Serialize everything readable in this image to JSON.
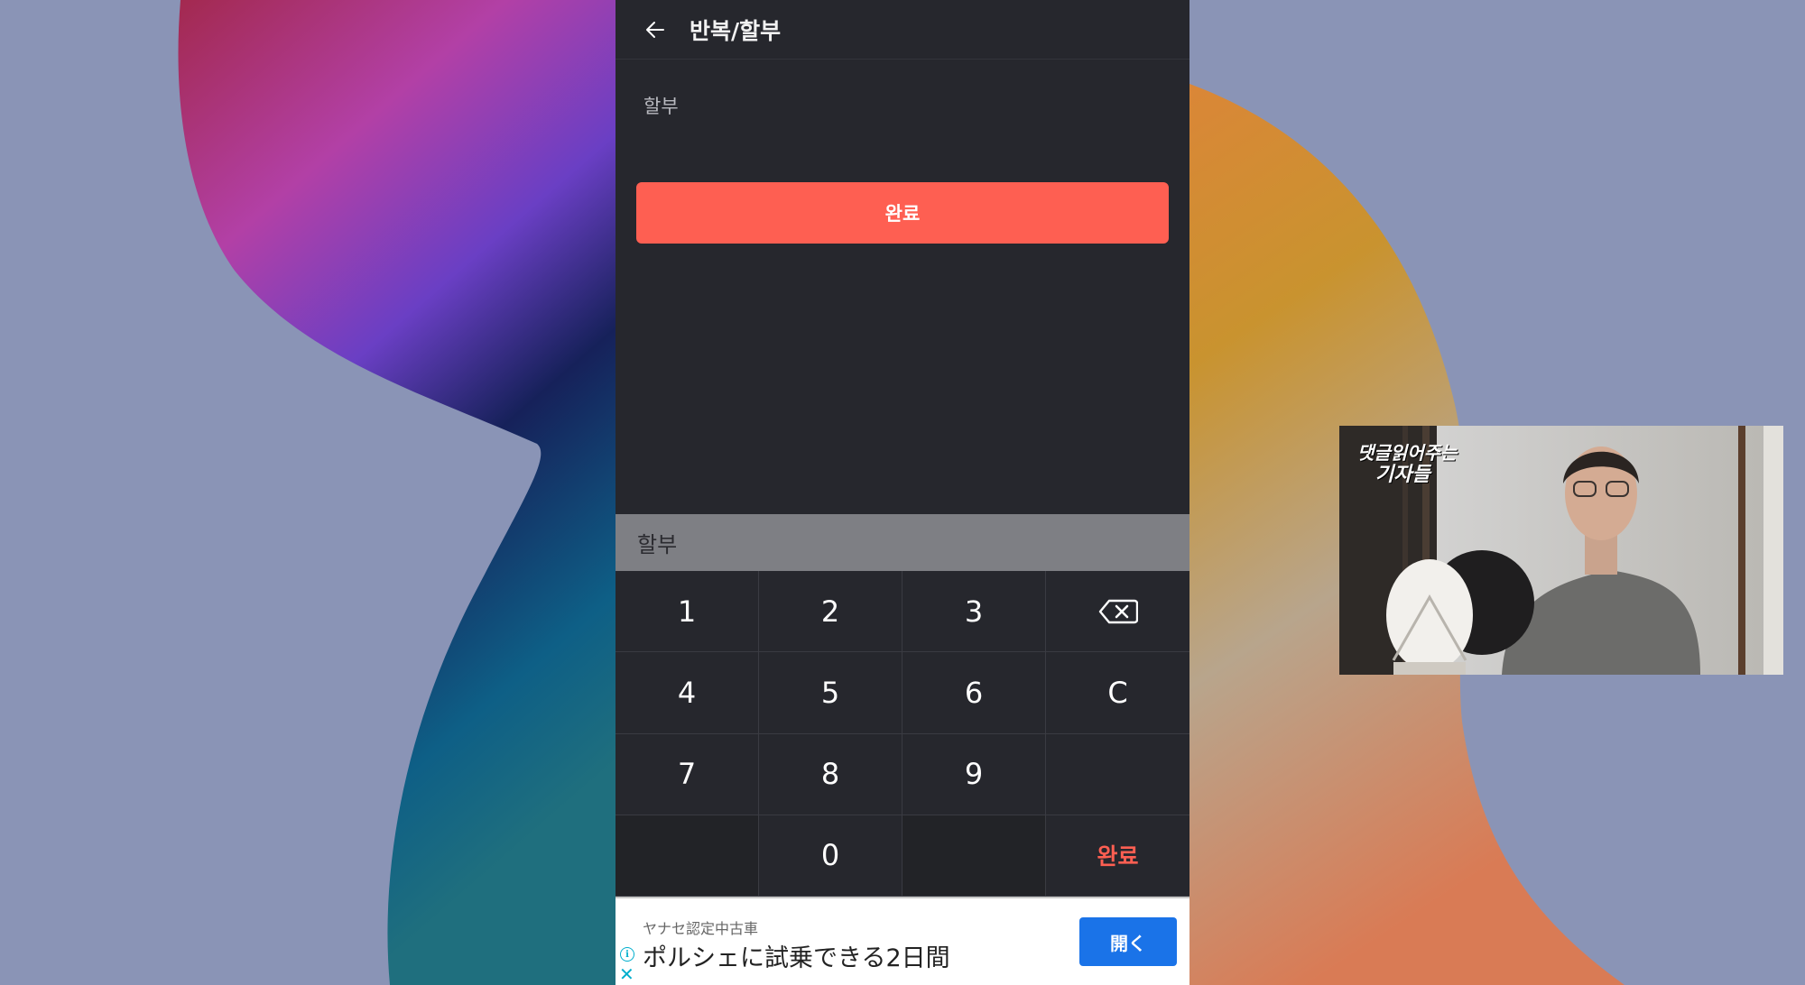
{
  "app": {
    "title": "반복/할부",
    "back_icon": "arrow-left-icon",
    "field_label": "할부",
    "done_button": "완료",
    "accent": "#fe5f52",
    "background": "#26272d"
  },
  "keypad": {
    "header": "할부",
    "keys": [
      "1",
      "2",
      "3",
      "backspace",
      "4",
      "5",
      "6",
      "C",
      "7",
      "8",
      "9",
      "",
      "",
      "0",
      "",
      "완료"
    ],
    "backspace_icon": "backspace-icon"
  },
  "ad": {
    "sponsor": "ヤナセ認定中古車",
    "headline": "ポルシェに試乗できる2日間",
    "open_button": "開く",
    "info_icon": "info-icon",
    "close_icon": "close-icon"
  },
  "video": {
    "overlay_line1": "댓글읽어주는",
    "overlay_line2": "기자들"
  }
}
